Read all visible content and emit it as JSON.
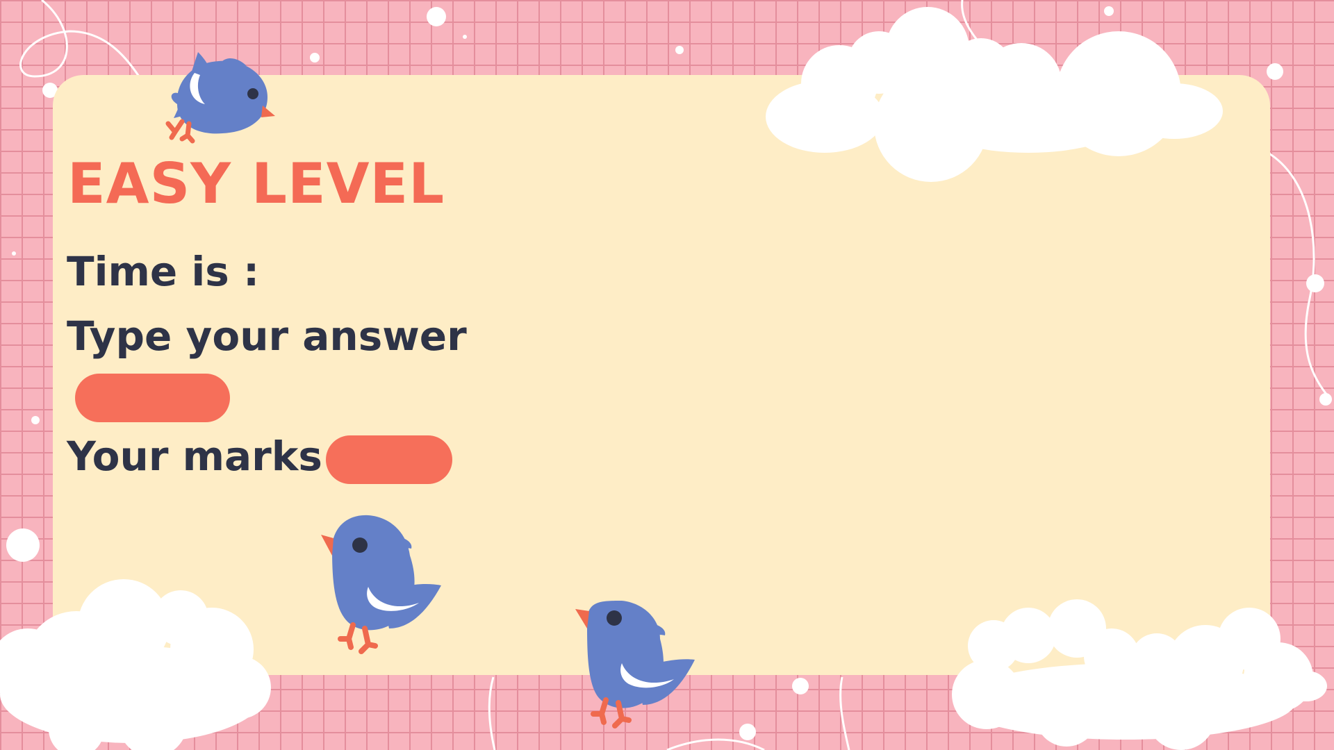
{
  "game": {
    "title": "EASY LEVEL",
    "time_label": "Time is :",
    "time_value": "",
    "answer_label": "Type your answer",
    "answer_value": "",
    "answer_placeholder": "",
    "marks_label": "Your marks",
    "marks_value": ""
  },
  "colors": {
    "background": "#F8B4BE",
    "grid_lines": "#E48E9C",
    "card": "#FEEDC6",
    "title": "#F46A55",
    "label_text": "#2E3347",
    "pill": "#F66F5A",
    "bird_body": "#6480C8",
    "bird_beak": "#EF6A4E",
    "cloud": "#FFFFFF"
  },
  "decorations": {
    "birds": [
      "bird-icon",
      "bird-icon",
      "bird-icon"
    ],
    "clouds": [
      "cloud-icon",
      "cloud-icon",
      "cloud-icon"
    ]
  }
}
